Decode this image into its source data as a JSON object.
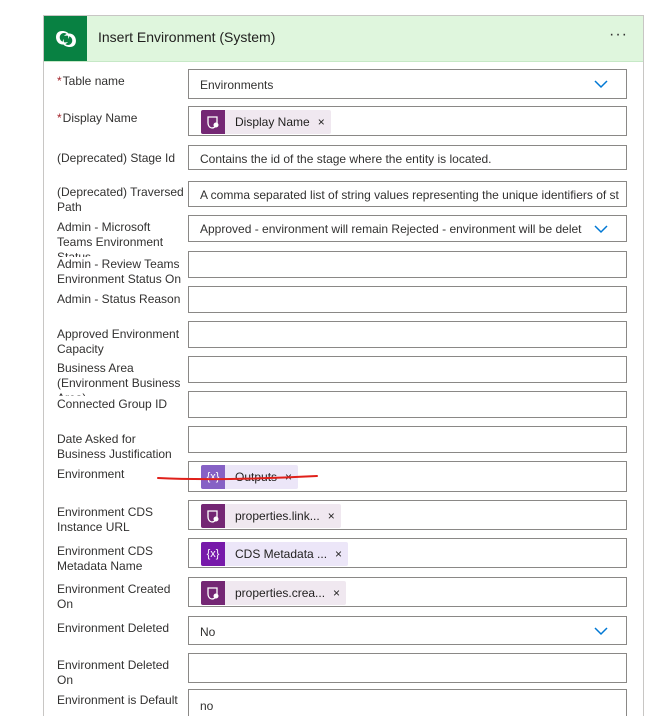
{
  "header": {
    "title": "Insert Environment (System)",
    "menu_label": "···",
    "accent_color": "#088142",
    "bg_color": "#dff6dd"
  },
  "fields": {
    "table_name": {
      "label": "Table name",
      "required": "*",
      "value": "Environments"
    },
    "display_name": {
      "label": "Display Name",
      "required": "*",
      "token": "Display Name"
    },
    "stage_id": {
      "label": "(Deprecated) Stage Id",
      "value": "Contains the id of the stage where the entity is located."
    },
    "traversed_path": {
      "label": "(Deprecated) Traversed Path",
      "value": "A comma separated list of string values representing the unique identifiers of st"
    },
    "teams_env_status": {
      "label": "Admin - Microsoft Teams Environment Status",
      "value": "Approved - environment will remain Rejected - environment will be delet"
    },
    "review_teams": {
      "label": "Admin - Review Teams Environment Status On",
      "value": ""
    },
    "status_reason": {
      "label": "Admin - Status Reason",
      "value": ""
    },
    "approved_capacity": {
      "label": "Approved Environment Capacity",
      "value": ""
    },
    "business_area": {
      "label": "Business Area (Environment Business Area)",
      "value": ""
    },
    "connected_group": {
      "label": "Connected Group ID",
      "value": ""
    },
    "date_asked": {
      "label": "Date Asked for Business Justification",
      "value": ""
    },
    "environment": {
      "label": "Environment",
      "token": "Outputs",
      "token_icon": "{x}"
    },
    "cds_url": {
      "label": "Environment CDS Instance URL",
      "token": "properties.link..."
    },
    "cds_metadata": {
      "label": "Environment CDS Metadata Name",
      "token": "CDS Metadata ...",
      "token_icon": "{x}"
    },
    "created_on": {
      "label": "Environment Created On",
      "token": "properties.crea..."
    },
    "deleted": {
      "label": "Environment Deleted",
      "value": "No"
    },
    "deleted_on": {
      "label": "Environment Deleted On",
      "value": ""
    },
    "is_default": {
      "label": "Environment is Default",
      "value": "no"
    }
  },
  "token_close": "×"
}
